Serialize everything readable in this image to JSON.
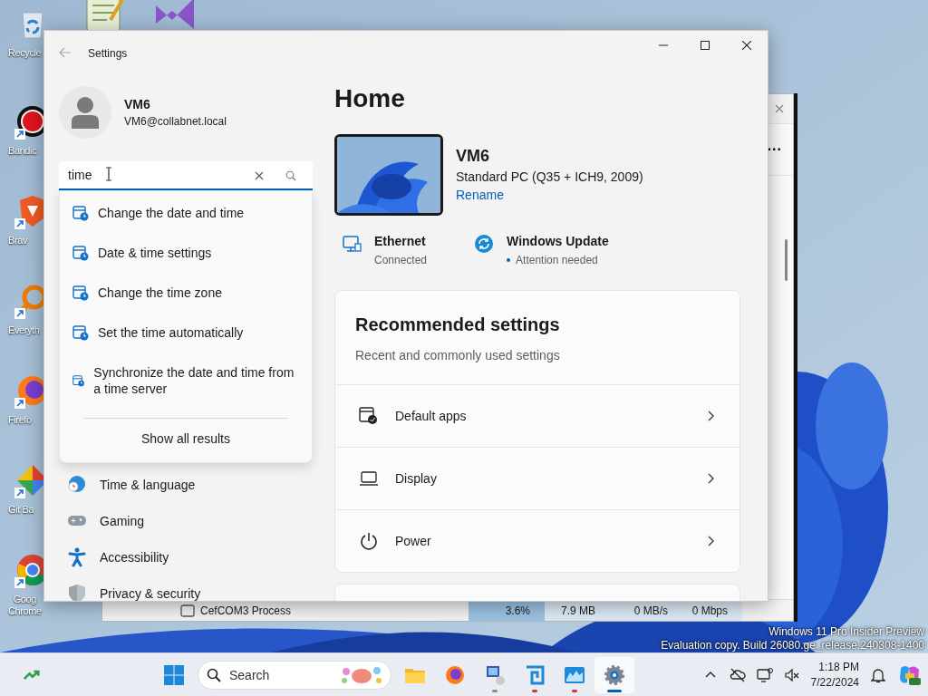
{
  "desktop_icons": [
    {
      "label": "Recycle"
    },
    {
      "label": "Bandic"
    },
    {
      "label": "Brav"
    },
    {
      "label": "Everyth"
    },
    {
      "label": "Firefo"
    },
    {
      "label": "Git Ba"
    },
    {
      "label": "Goog\nChrome"
    }
  ],
  "background_window": {
    "more": "...",
    "row": {
      "name": "CefCOM3 Process",
      "cpu": "3.6%",
      "memory": "7.9 MB",
      "disk": "0 MB/s",
      "network": "0 Mbps"
    }
  },
  "settings": {
    "window": {
      "title": "Settings"
    },
    "user": {
      "name": "VM6",
      "email": "VM6@collabnet.local"
    },
    "search": {
      "value": "time"
    },
    "results": [
      {
        "label": "Change the date and time"
      },
      {
        "label": "Date & time settings"
      },
      {
        "label": "Change the time zone"
      },
      {
        "label": "Set the time automatically"
      },
      {
        "label": "Synchronize the date and time from a time server"
      }
    ],
    "show_all": "Show all results",
    "nav": [
      {
        "label": "Time & language"
      },
      {
        "label": "Gaming"
      },
      {
        "label": "Accessibility"
      },
      {
        "label": "Privacy & security"
      }
    ],
    "home": {
      "heading": "Home",
      "device": {
        "name": "VM6",
        "model": "Standard PC (Q35 + ICH9, 2009)",
        "rename": "Rename"
      },
      "status": [
        {
          "title": "Ethernet",
          "detail": "Connected",
          "alert": false
        },
        {
          "title": "Windows Update",
          "detail": "Attention needed",
          "alert": true
        }
      ],
      "recommended": {
        "title": "Recommended settings",
        "subtitle": "Recent and commonly used settings",
        "items": [
          {
            "label": "Default apps"
          },
          {
            "label": "Display"
          },
          {
            "label": "Power"
          }
        ]
      }
    }
  },
  "watermark": [
    "Windows 11 Pro Insider Preview",
    "Evaluation copy. Build 26080.ge_release.240308-1400"
  ],
  "taskbar": {
    "search": {
      "placeholder": "Search"
    },
    "apps": [
      {
        "open": false,
        "alert": false,
        "active": false
      },
      {
        "open": false,
        "alert": false,
        "active": false
      },
      {
        "open": true,
        "alert": false,
        "active": false
      },
      {
        "open": false,
        "alert": true,
        "active": false
      },
      {
        "open": false,
        "alert": true,
        "active": false
      },
      {
        "open": false,
        "alert": false,
        "active": true
      }
    ],
    "clock": {
      "time": "1:18 PM",
      "date": "7/22/2024"
    }
  }
}
